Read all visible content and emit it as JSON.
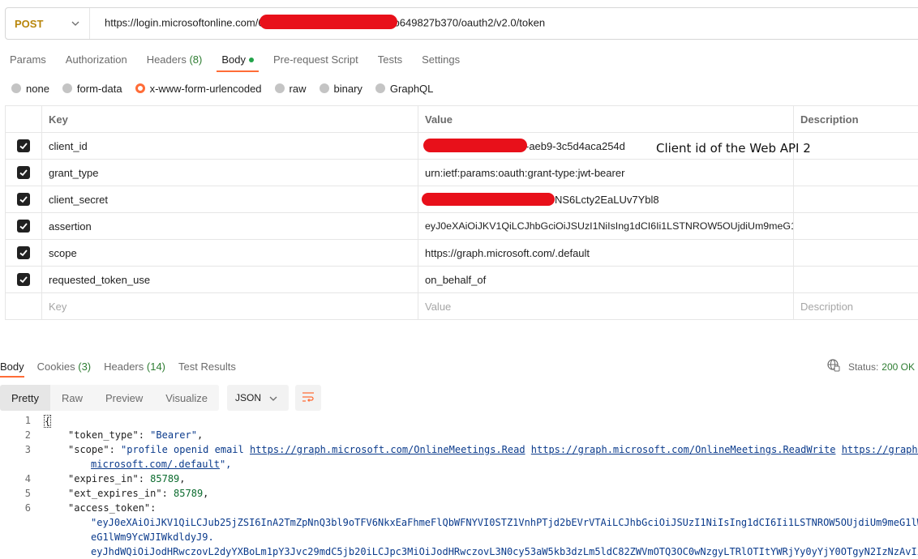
{
  "request": {
    "method": "POST",
    "url_prefix": "https://login.microsoftonline.com/6",
    "url_suffix": "b649827b370/oauth2/v2.0/token"
  },
  "request_tabs": [
    {
      "label": "Params",
      "count": "",
      "active": false
    },
    {
      "label": "Authorization",
      "count": "",
      "active": false
    },
    {
      "label": "Headers",
      "count": "(8)",
      "active": false
    },
    {
      "label": "Body",
      "count": "",
      "active": true
    },
    {
      "label": "Pre-request Script",
      "count": "",
      "active": false
    },
    {
      "label": "Tests",
      "count": "",
      "active": false
    },
    {
      "label": "Settings",
      "count": "",
      "active": false
    }
  ],
  "body_types": [
    {
      "label": "none",
      "selected": false
    },
    {
      "label": "form-data",
      "selected": false
    },
    {
      "label": "x-www-form-urlencoded",
      "selected": true
    },
    {
      "label": "raw",
      "selected": false
    },
    {
      "label": "binary",
      "selected": false
    },
    {
      "label": "GraphQL",
      "selected": false
    }
  ],
  "table": {
    "headers": {
      "key": "Key",
      "value": "Value",
      "description": "Description"
    },
    "rows": [
      {
        "key": "client_id",
        "value": "-aeb9-3c5d4aca254d",
        "redacted": true
      },
      {
        "key": "grant_type",
        "value": "urn:ietf:params:oauth:grant-type:jwt-bearer",
        "redacted": false
      },
      {
        "key": "client_secret",
        "value": "NS6Lcty2EaLUv7Ybl8",
        "redacted": true
      },
      {
        "key": "assertion",
        "value": "eyJ0eXAiOiJKV1QiLCJhbGciOiJSUzI1NiIsIng1dCI6Ii1LSTNROW5OUjdiUm9meG1",
        "redacted": false
      },
      {
        "key": "scope",
        "value": "https://graph.microsoft.com/.default",
        "redacted": false
      },
      {
        "key": "requested_token_use",
        "value": "on_behalf_of",
        "redacted": false
      }
    ],
    "placeholder": {
      "key": "Key",
      "value": "Value",
      "description": "Description"
    }
  },
  "annotation": "Client id of the Web API 2",
  "response_tabs": [
    {
      "label": "Body",
      "count": "",
      "active": true
    },
    {
      "label": "Cookies",
      "count": "(3)",
      "active": false
    },
    {
      "label": "Headers",
      "count": "(14)",
      "active": false
    },
    {
      "label": "Test Results",
      "count": "",
      "active": false
    }
  ],
  "status": {
    "label": "Status:",
    "value": "200 OK"
  },
  "view_modes": [
    "Pretty",
    "Raw",
    "Preview",
    "Visualize"
  ],
  "format": "JSON",
  "code": {
    "line_numbers": [
      "1",
      "2",
      "3",
      "4",
      "5",
      "6"
    ],
    "open_brace": "{",
    "token_type_key": "\"token_type\"",
    "token_type_value": "\"Bearer\"",
    "scope_key": "\"scope\"",
    "scope_value_start": "\"profile openid email ",
    "scope_url_1": "https://graph.microsoft.com/OnlineMeetings.Read",
    "scope_url_2": "https://graph.microsoft.com/OnlineMeetings.ReadWrite",
    "scope_url_3": "https://graph.",
    "scope_url_3_cont": "microsoft.com/.default",
    "scope_value_end": "\",",
    "expires_in_key": "\"expires_in\"",
    "expires_in_value": "85789",
    "ext_expires_in_key": "\"ext_expires_in\"",
    "ext_expires_in_value": "85789",
    "access_token_key": "\"access_token\"",
    "access_token_line1": "\"eyJ0eXAiOiJKV1QiLCJub25jZSI6InA2TmZpNnQ3bl9oTFV6NkxEaFhmeFlQbWFNYVI0STZ1VnhPTjd2bEVrVTAiLCJhbGciOiJSUzI1NiIsIng1dCI6Ii1LSTNROW5OUjdiUm9meG1lW",
    "access_token_line2": "eG1lWm9YcWJIWkdldyJ9.",
    "access_token_line3": "eyJhdWQiOiJodHRwczovL2dyYXBoLm1pY3Jvc29mdC5jb20iLCJpc3MiOiJodHRwczovL3N0cy53aW5kb3dzLm5ldC82ZWVmOTQ3OC0wNzgyLTRlOTItYWRjYy0yYjY0OTgyN2IzNzAvIi"
  }
}
